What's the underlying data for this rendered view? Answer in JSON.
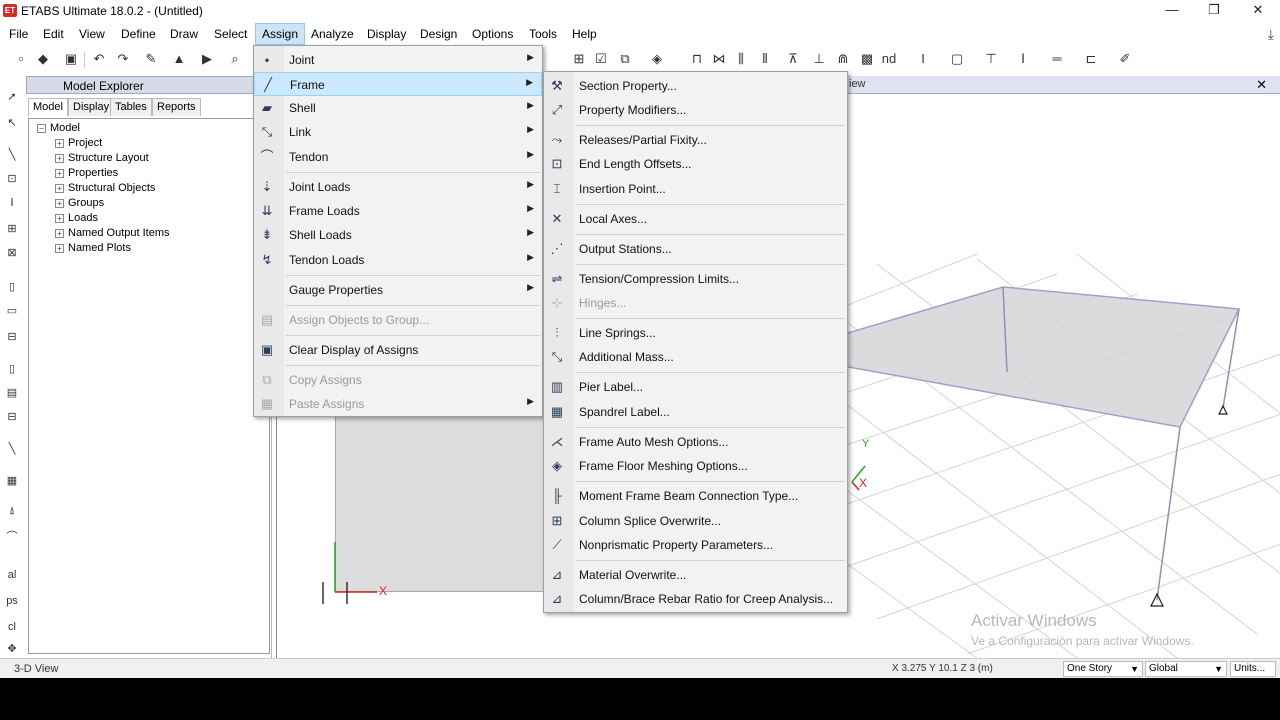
{
  "window": {
    "app_icon": "ET",
    "title": "ETABS Ultimate 18.0.2 - (Untitled)",
    "minimize": "—",
    "restore": "❐",
    "close": "✕"
  },
  "menubar": {
    "items": [
      "File",
      "Edit",
      "View",
      "Define",
      "Draw",
      "Select",
      "Assign",
      "Analyze",
      "Display",
      "Design",
      "Options",
      "Tools",
      "Help"
    ],
    "active": "Assign"
  },
  "explorer": {
    "title": "Model Explorer",
    "tabs": [
      "Model",
      "Display",
      "Tables",
      "Reports"
    ],
    "root": "Model",
    "items": [
      "Project",
      "Structure Layout",
      "Properties",
      "Structural Objects",
      "Groups",
      "Loads",
      "Named Output Items",
      "Named Plots"
    ]
  },
  "view": {
    "tab_label": "iew",
    "axis_x": "X",
    "axis_y": "Y"
  },
  "assign_menu": {
    "items": [
      {
        "label": "Joint",
        "icon": "joint-icon",
        "glyph": "⬩",
        "submenu": true
      },
      {
        "label": "Frame",
        "icon": "frame-icon",
        "glyph": "╱",
        "submenu": true
      },
      {
        "label": "Shell",
        "icon": "shell-icon",
        "glyph": "▰",
        "submenu": true
      },
      {
        "label": "Link",
        "icon": "link-icon",
        "glyph": "⤡",
        "submenu": true
      },
      {
        "label": "Tendon",
        "icon": "tendon-icon",
        "glyph": "⌒",
        "submenu": true
      },
      {
        "label": "Joint Loads",
        "icon": "joint-loads-icon",
        "glyph": "⇣",
        "submenu": true
      },
      {
        "label": "Frame Loads",
        "icon": "frame-loads-icon",
        "glyph": "⇊",
        "submenu": true
      },
      {
        "label": "Shell Loads",
        "icon": "shell-loads-icon",
        "glyph": "⇟",
        "submenu": true
      },
      {
        "label": "Tendon Loads",
        "icon": "tendon-loads-icon",
        "glyph": "↯",
        "submenu": true
      },
      {
        "label": "Gauge Properties",
        "icon": "gauge-icon",
        "glyph": "",
        "submenu": true
      },
      {
        "label": "Assign Objects to Group...",
        "icon": "group-icon",
        "glyph": "▤",
        "submenu": false,
        "disabled": true
      },
      {
        "label": "Clear Display of Assigns",
        "icon": "clear-display-icon",
        "glyph": "▣",
        "submenu": false
      },
      {
        "label": "Copy Assigns",
        "icon": "copy-icon",
        "glyph": "⧉",
        "submenu": false,
        "disabled": true
      },
      {
        "label": "Paste Assigns",
        "icon": "paste-icon",
        "glyph": "▦",
        "submenu": true,
        "disabled": true
      }
    ]
  },
  "frame_menu": {
    "items": [
      {
        "label": "Section Property...",
        "icon": "section-property-icon",
        "glyph": "⚒"
      },
      {
        "label": "Property Modifiers...",
        "icon": "property-modifiers-icon",
        "glyph": "⤢"
      },
      {
        "label": "Releases/Partial Fixity...",
        "icon": "releases-icon",
        "glyph": "⤳"
      },
      {
        "label": "End Length Offsets...",
        "icon": "end-offsets-icon",
        "glyph": "⊡"
      },
      {
        "label": "Insertion Point...",
        "icon": "insertion-point-icon",
        "glyph": "⌶"
      },
      {
        "label": "Local Axes...",
        "icon": "local-axes-icon",
        "glyph": "✕"
      },
      {
        "label": "Output Stations...",
        "icon": "output-stations-icon",
        "glyph": "⋰"
      },
      {
        "label": "Tension/Compression Limits...",
        "icon": "tc-limits-icon",
        "glyph": "⇌"
      },
      {
        "label": "Hinges...",
        "icon": "hinges-icon",
        "glyph": "⊹",
        "disabled": true
      },
      {
        "label": "Line Springs...",
        "icon": "line-springs-icon",
        "glyph": "⫶"
      },
      {
        "label": "Additional Mass...",
        "icon": "additional-mass-icon",
        "glyph": "⤡"
      },
      {
        "label": "Pier Label...",
        "icon": "pier-label-icon",
        "glyph": "▥"
      },
      {
        "label": "Spandrel Label...",
        "icon": "spandrel-label-icon",
        "glyph": "▦"
      },
      {
        "label": "Frame Auto Mesh Options...",
        "icon": "auto-mesh-icon",
        "glyph": "⋌"
      },
      {
        "label": "Frame Floor Meshing Options...",
        "icon": "floor-meshing-icon",
        "glyph": "◈"
      },
      {
        "label": "Moment Frame Beam Connection Type...",
        "icon": "beam-connection-icon",
        "glyph": "╟"
      },
      {
        "label": "Column Splice Overwrite...",
        "icon": "column-splice-icon",
        "glyph": "⊞"
      },
      {
        "label": "Nonprismatic Property Parameters...",
        "icon": "nonprismatic-icon",
        "glyph": "⟋"
      },
      {
        "label": "Material Overwrite...",
        "icon": "material-overwrite-icon",
        "glyph": "⊿"
      },
      {
        "label": "Column/Brace Rebar Ratio for Creep Analysis...",
        "icon": "rebar-ratio-icon",
        "glyph": "⊿"
      }
    ]
  },
  "statusbar": {
    "left": "3-D View",
    "coords": "X 3.275  Y 10.1  Z 3 (m)",
    "story": "One Story",
    "system": "Global",
    "units": "Units..."
  },
  "watermark": {
    "line1": "Activar Windows",
    "line2": "Ve a Configuración para activar Windows."
  }
}
